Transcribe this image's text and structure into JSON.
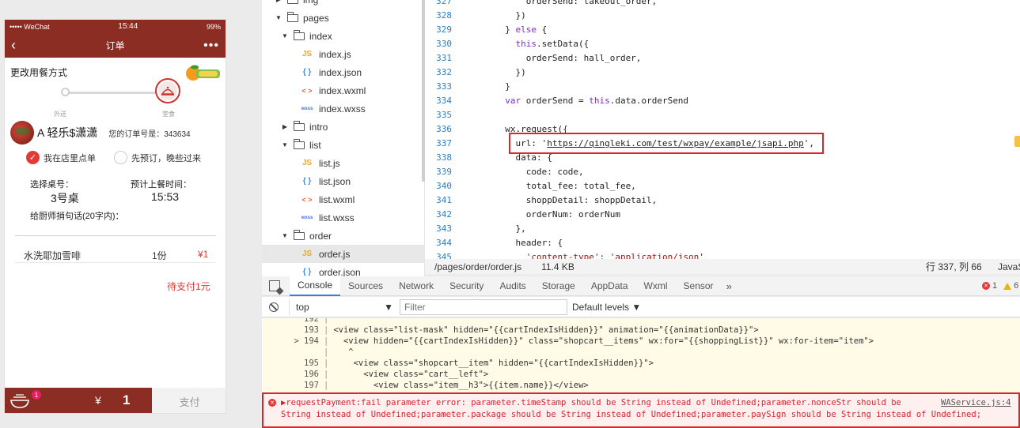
{
  "phone": {
    "status": {
      "carrier": "••••• WeChat",
      "time": "15:44",
      "battery": "99%"
    },
    "nav": {
      "back": "‹",
      "title": "订单",
      "more": "•••"
    },
    "change_method": "更改用餐方式",
    "mode_left": "外送",
    "mode_right": "堂食",
    "user_name": "A 轻乐$潇潇",
    "order_no": "您的订单号是：343634",
    "option_dine_in": "我在店里点单",
    "option_preorder": "先预订，晚些过来",
    "table_label": "选择桌号：",
    "table_value": "3号桌",
    "time_label": "预计上餐时间：",
    "time_value": "15:53",
    "note_label": "给厨师捎句话(20字内)：",
    "item": {
      "name": "水洗耶加雪啡",
      "qty": "1份",
      "price": "¥1"
    },
    "pending": "待支付1元",
    "cart_count": "1",
    "currency": "¥",
    "total": "1",
    "pay_label": "支付",
    "colors": {
      "brand": "#8b2d22",
      "accent": "#e53935"
    }
  },
  "tree": {
    "items": [
      {
        "label": "img",
        "kind": "folder",
        "arrow": "▶"
      },
      {
        "label": "pages",
        "kind": "folder",
        "arrow": "▼"
      },
      {
        "label": "index",
        "kind": "folder",
        "arrow": "▼"
      },
      {
        "label": "index.js",
        "kind": "js",
        "icon": "JS"
      },
      {
        "label": "index.json",
        "kind": "json",
        "icon": "{ }"
      },
      {
        "label": "index.wxml",
        "kind": "wxml",
        "icon": "< >"
      },
      {
        "label": "index.wxss",
        "kind": "wxss",
        "icon": "wxss"
      },
      {
        "label": "intro",
        "kind": "folder",
        "arrow": "▶"
      },
      {
        "label": "list",
        "kind": "folder",
        "arrow": "▼"
      },
      {
        "label": "list.js",
        "kind": "js",
        "icon": "JS"
      },
      {
        "label": "list.json",
        "kind": "json",
        "icon": "{ }"
      },
      {
        "label": "list.wxml",
        "kind": "wxml",
        "icon": "< >"
      },
      {
        "label": "list.wxss",
        "kind": "wxss",
        "icon": "wxss"
      },
      {
        "label": "order",
        "kind": "folder",
        "arrow": "▼"
      },
      {
        "label": "order.js",
        "kind": "js",
        "icon": "JS"
      },
      {
        "label": "order.json",
        "kind": "json",
        "icon": "{ }"
      }
    ]
  },
  "editor": {
    "lines": [
      {
        "n": "327",
        "text": "      orderSend: takeout_order,"
      },
      {
        "n": "328",
        "text": "    })"
      },
      {
        "n": "329",
        "text": "  } else {"
      },
      {
        "n": "330",
        "text": "    this.setData({"
      },
      {
        "n": "331",
        "text": "      orderSend: hall_order,"
      },
      {
        "n": "332",
        "text": "    })"
      },
      {
        "n": "333",
        "text": "  }"
      },
      {
        "n": "334",
        "text": "  var orderSend = this.data.orderSend"
      },
      {
        "n": "335",
        "text": ""
      },
      {
        "n": "336",
        "text": "  wx.request({"
      },
      {
        "n": "337",
        "text": "    url: 'https://qingleki.com/test/wxpay/example/jsapi.php',"
      },
      {
        "n": "338",
        "text": "    data: {"
      },
      {
        "n": "339",
        "text": "      code: code,"
      },
      {
        "n": "340",
        "text": "      total_fee: total_fee,"
      },
      {
        "n": "341",
        "text": "      shoppDetail: shoppDetail,"
      },
      {
        "n": "342",
        "text": "      orderNum: orderNum"
      },
      {
        "n": "343",
        "text": "    },"
      },
      {
        "n": "344",
        "text": "    header: {"
      },
      {
        "n": "345",
        "text": "      'content-type': 'application/json'"
      }
    ],
    "status_path": "/pages/order/order.js",
    "status_size": "11.4 KB",
    "status_pos": "行 337, 列 66",
    "status_lang": "JavaS"
  },
  "devtools": {
    "tabs": [
      "Console",
      "Sources",
      "Network",
      "Security",
      "Audits",
      "Storage",
      "AppData",
      "Wxml",
      "Sensor"
    ],
    "more_tabs": "»",
    "error_count": "1",
    "warning_count": "6",
    "context": "top",
    "filter_placeholder": "Filter",
    "levels": "Default levels ▼",
    "console_lines": [
      {
        "n": "192",
        "text": ""
      },
      {
        "n": "193",
        "text": "<view class=\"list-mask\" hidden=\"{{cartIndexIsHidden}}\" animation=\"{{animationData}}\">"
      },
      {
        "n": "> 194",
        "text": "  <view hidden=\"{{cartIndexIsHidden}}\" class=\"shopcart__items\" wx:for=\"{{shoppingList}}\" wx:for-item=\"item\">"
      },
      {
        "n": "",
        "text": "   ^"
      },
      {
        "n": "195",
        "text": "    <view class=\"shopcart__item\" hidden=\"{{cartIndexIsHidden}}\">"
      },
      {
        "n": "196",
        "text": "      <view class=\"cart__left\">"
      },
      {
        "n": "197",
        "text": "        <view class=\"item__h3\">{{item.name}}</view>"
      }
    ],
    "error_line1": "▶requestPayment:fail parameter error: parameter.timeStamp should be String instead of Undefined;parameter.nonceStr should be",
    "error_line2": "String instead of Undefined;parameter.package should be String instead of Undefined;parameter.paySign should be String instead of Undefined;",
    "error_source": "WAService.js:4"
  }
}
